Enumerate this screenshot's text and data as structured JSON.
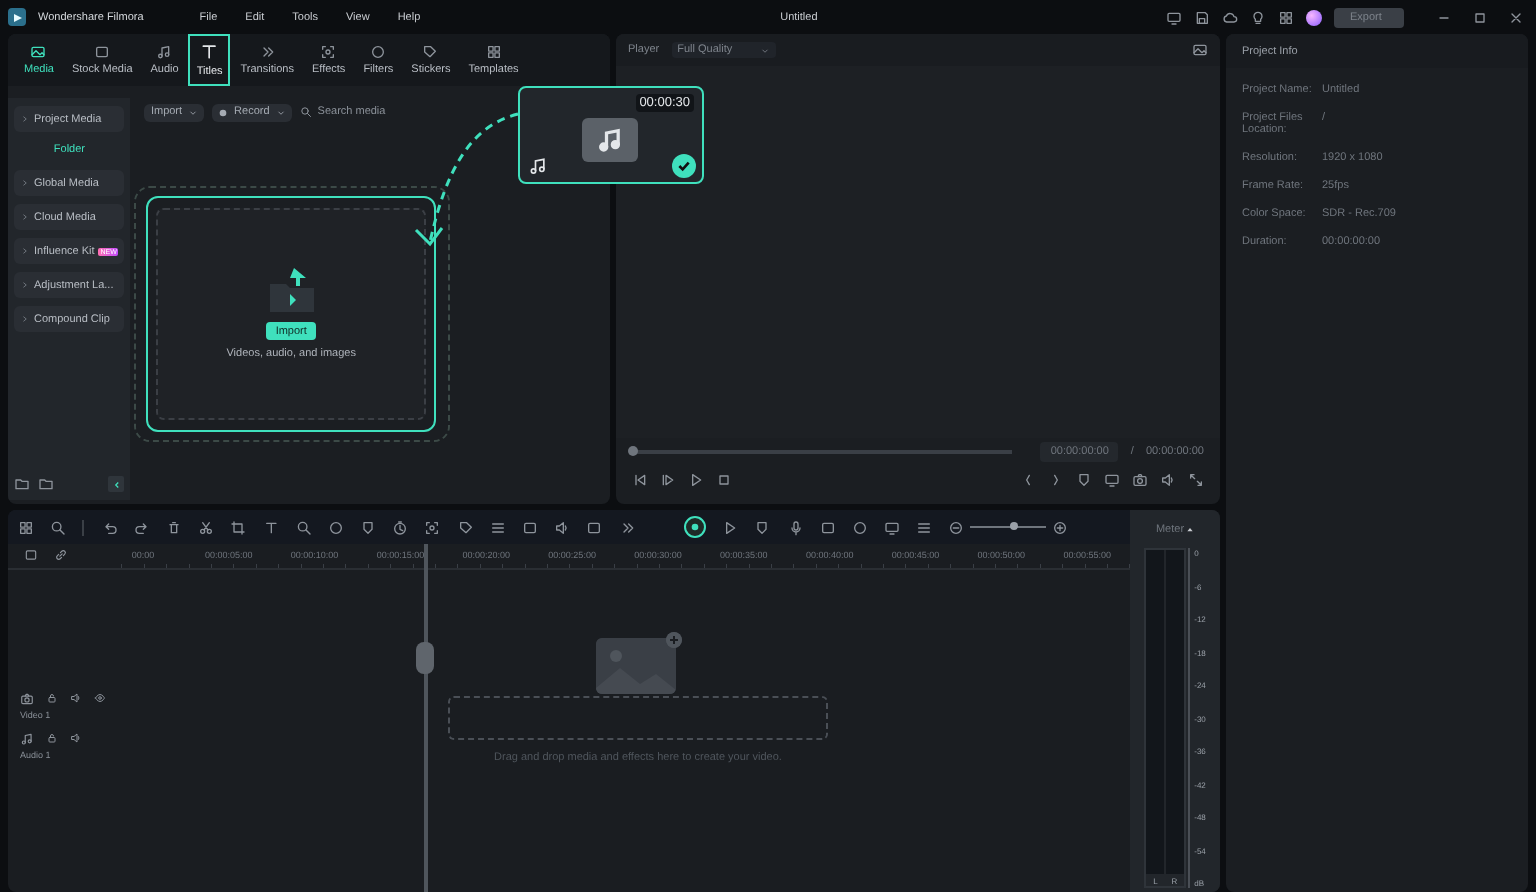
{
  "window": {
    "app_name": "Wondershare Filmora",
    "menu": [
      "File",
      "Edit",
      "Tools",
      "View",
      "Help"
    ],
    "title": "Untitled",
    "export_button": "Export"
  },
  "media_tabs": [
    {
      "label": "Media",
      "selected": true,
      "highlighted": false
    },
    {
      "label": "Stock Media",
      "selected": false,
      "highlighted": false
    },
    {
      "label": "Audio",
      "selected": false,
      "highlighted": false
    },
    {
      "label": "Titles",
      "selected": false,
      "highlighted": true
    },
    {
      "label": "Transitions",
      "selected": false,
      "highlighted": false
    },
    {
      "label": "Effects",
      "selected": false,
      "highlighted": false
    },
    {
      "label": "Filters",
      "selected": false,
      "highlighted": false
    },
    {
      "label": "Stickers",
      "selected": false,
      "highlighted": false
    },
    {
      "label": "Templates",
      "selected": false,
      "highlighted": false
    }
  ],
  "media_sidebar": {
    "items": [
      {
        "label": "Project Media",
        "children": [
          {
            "label": "Folder",
            "selected": true
          }
        ]
      },
      {
        "label": "Global Media"
      },
      {
        "label": "Cloud Media"
      },
      {
        "label": "Influence Kit",
        "badge": "NEW"
      },
      {
        "label": "Adjustment La..."
      },
      {
        "label": "Compound Clip"
      }
    ]
  },
  "media_toolbar": {
    "import": "Import",
    "record": "Record",
    "search_placeholder": "Search media"
  },
  "drop_zone": {
    "button": "Import",
    "hint": "Videos, audio, and images"
  },
  "drag_card": {
    "duration": "00:00:30",
    "checked": true
  },
  "player": {
    "label": "Player",
    "quality": "Full Quality",
    "progress": {
      "level": 0
    },
    "current_time": "00:00:00:00",
    "separator": "/",
    "total_time": "00:00:00:00"
  },
  "project_info": {
    "title": "Project Info",
    "fields": [
      {
        "label": "Project Name:",
        "value": "Untitled"
      },
      {
        "label": "Project Files Location:",
        "value": "/"
      },
      {
        "label": "Resolution:",
        "value": "1920 x 1080"
      },
      {
        "label": "Frame Rate:",
        "value": "25fps"
      },
      {
        "label": "Color Space:",
        "value": "SDR - Rec.709"
      },
      {
        "label": "Duration:",
        "value": "00:00:00:00"
      }
    ]
  },
  "timeline": {
    "toolbar_toggle": {
      "on": true
    },
    "zoom": {
      "level": 0.57
    },
    "ruler": [
      "00:00",
      "00:00:05:00",
      "00:00:10:00",
      "00:00:15:00",
      "00:00:20:00",
      "00:00:25:00",
      "00:00:30:00",
      "00:00:35:00",
      "00:00:40:00",
      "00:00:45:00",
      "00:00:50:00",
      "00:00:55:00"
    ],
    "tracks": [
      {
        "name": "Video 1",
        "kind": "video"
      },
      {
        "name": "Audio 1",
        "kind": "audio"
      }
    ],
    "drop_hint": "Drag and drop media and effects here to create your video."
  },
  "meter": {
    "title": "Meter",
    "scale": [
      "0",
      "-6",
      "-12",
      "-18",
      "-24",
      "-30",
      "-36",
      "-42",
      "-48",
      "-54"
    ],
    "unit": "dB",
    "channels": [
      "L",
      "R"
    ]
  }
}
